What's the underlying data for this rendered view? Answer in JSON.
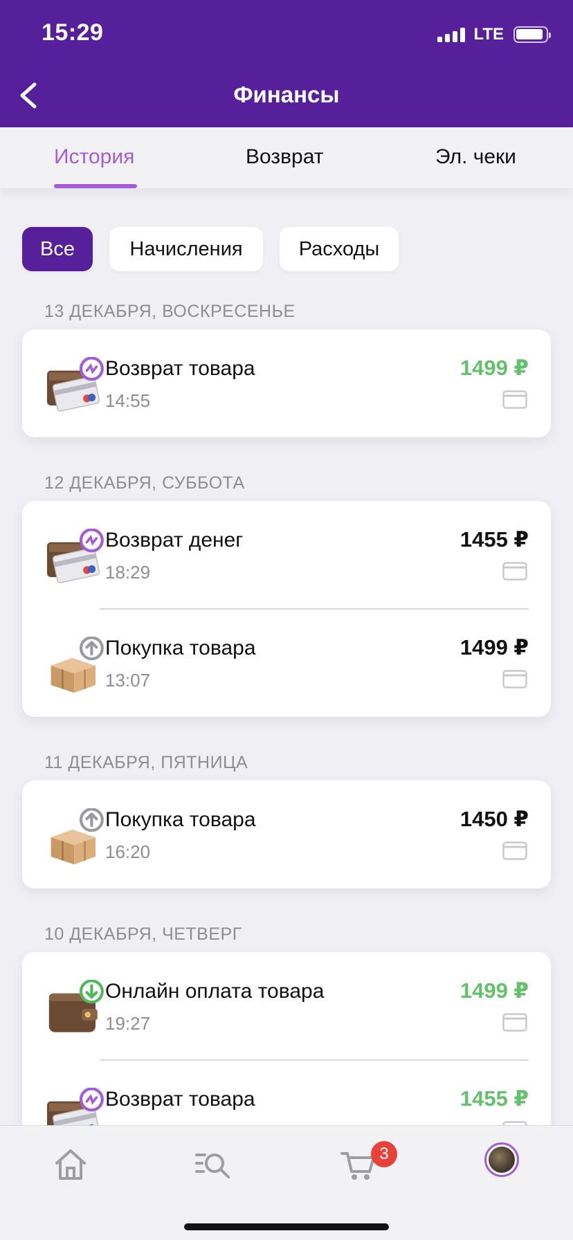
{
  "status": {
    "time": "15:29",
    "network": "LTE"
  },
  "header": {
    "title": "Финансы"
  },
  "tabs": [
    {
      "label": "История",
      "active": true
    },
    {
      "label": "Возврат",
      "active": false
    },
    {
      "label": "Эл. чеки",
      "active": false
    }
  ],
  "filters": [
    {
      "label": "Все",
      "active": true
    },
    {
      "label": "Начисления",
      "active": false
    },
    {
      "label": "Расходы",
      "active": false
    }
  ],
  "groups": [
    {
      "date": "13 ДЕКАБРЯ, ВОСКРЕСЕНЬЕ",
      "items": [
        {
          "name": "Возврат товара",
          "time": "14:55",
          "amount": "1499 ₽",
          "amount_color": "green",
          "icon": "refund-card-icon"
        }
      ]
    },
    {
      "date": "12 ДЕКАБРЯ, СУББОТА",
      "items": [
        {
          "name": "Возврат денег",
          "time": "18:29",
          "amount": "1455 ₽",
          "amount_color": "black",
          "icon": "refund-card-icon"
        },
        {
          "name": "Покупка товара",
          "time": "13:07",
          "amount": "1499 ₽",
          "amount_color": "black",
          "icon": "purchase-box-icon"
        }
      ]
    },
    {
      "date": "11 ДЕКАБРЯ, ПЯТНИЦА",
      "items": [
        {
          "name": "Покупка товара",
          "time": "16:20",
          "amount": "1450 ₽",
          "amount_color": "black",
          "icon": "purchase-box-icon"
        }
      ]
    },
    {
      "date": "10 ДЕКАБРЯ, ЧЕТВЕРГ",
      "items": [
        {
          "name": "Онлайн оплата товара",
          "time": "19:27",
          "amount": "1499 ₽",
          "amount_color": "green",
          "icon": "wallet-icon"
        },
        {
          "name": "Возврат товара",
          "time": "",
          "amount": "1455 ₽",
          "amount_color": "green",
          "icon": "refund-card-icon"
        }
      ]
    }
  ],
  "bottom_nav": {
    "cart_badge": "3"
  },
  "colors": {
    "brand": "#56209a",
    "accent": "#a35bd8",
    "positive": "#63c16c",
    "badge": "#e8413a"
  }
}
